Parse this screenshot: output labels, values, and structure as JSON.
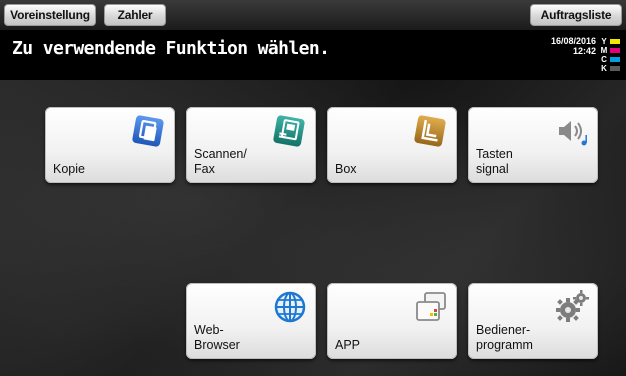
{
  "topbar": {
    "preset_label": "Voreinstellung",
    "counter_label": "Zahler",
    "joblist_label": "Auftragsliste"
  },
  "header": {
    "title": "Zu verwendende Funktion wählen.",
    "date": "16/08/2016",
    "time": "12:42"
  },
  "toner": [
    {
      "letter": "Y",
      "color": "#f5e400"
    },
    {
      "letter": "M",
      "color": "#e2007a"
    },
    {
      "letter": "C",
      "color": "#00a0e0"
    },
    {
      "letter": "K",
      "color": "#5a5a5a"
    }
  ],
  "tiles": {
    "copy": {
      "label": "Kopie",
      "icon": "copy-icon",
      "color": "#2f6fd0"
    },
    "scan": {
      "label": "Scannen/\nFax",
      "icon": "scan-fax-icon",
      "color": "#1a8f86"
    },
    "box": {
      "label": "Box",
      "icon": "box-icon",
      "color": "#b5832a"
    },
    "sound": {
      "label": "Tasten\nsignal",
      "icon": "speaker-icon",
      "color": "#7a7a7a"
    },
    "web": {
      "label": "Web-\nBrowser",
      "icon": "globe-icon",
      "color": "#1e78d0"
    },
    "app": {
      "label": "APP",
      "icon": "app-windows-icon",
      "color": "#9a9a9a"
    },
    "utility": {
      "label": "Bediener-\nprogramm",
      "icon": "gears-icon",
      "color": "#7d7d7d"
    }
  }
}
